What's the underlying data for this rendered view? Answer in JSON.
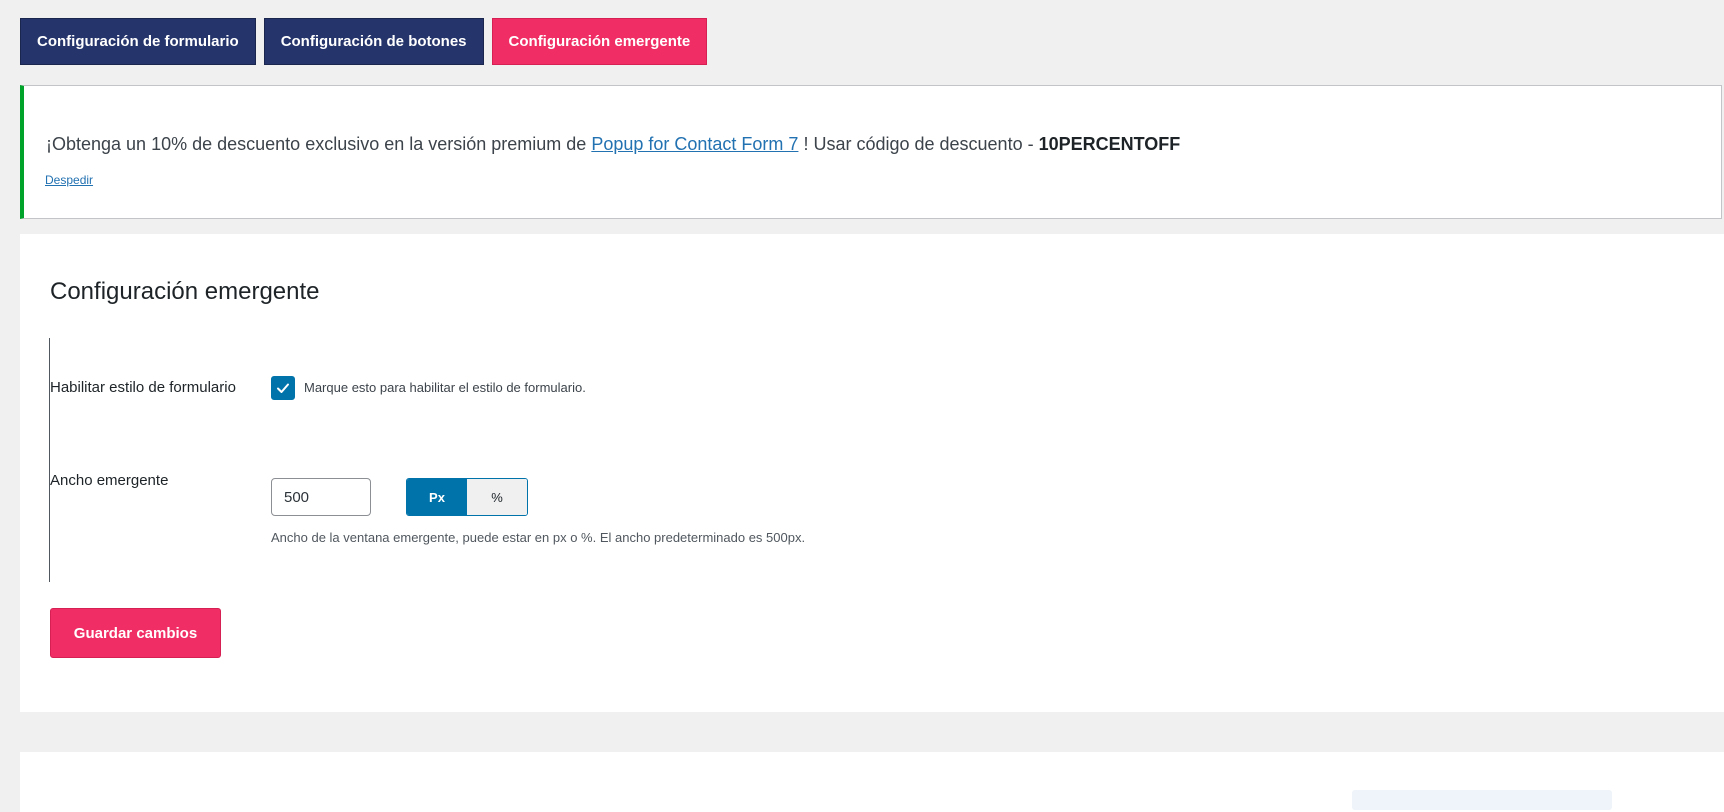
{
  "tabs": [
    {
      "label": "Configuración de formulario",
      "active": false
    },
    {
      "label": "Configuración de botones",
      "active": false
    },
    {
      "label": "Configuración emergente",
      "active": true
    }
  ],
  "notice": {
    "text_before": "¡Obtenga un 10% de descuento exclusivo en la versión premium de ",
    "link_text": "Popup for Contact Form 7",
    "text_after": " ! Usar código de descuento - ",
    "code": "10PERCENTOFF",
    "dismiss_label": "Despedir"
  },
  "settings": {
    "title": "Configuración emergente",
    "form_style": {
      "label": "Habilitar estilo de formulario",
      "checked": true,
      "description": "Marque esto para habilitar el estilo de formulario."
    },
    "popup_width": {
      "label": "Ancho emergente",
      "value": "500",
      "units": [
        "Px",
        "%"
      ],
      "selected_unit": "Px",
      "description": "Ancho de la ventana emergente, puede estar en px o %. El ancho predeterminado es 500px."
    },
    "save_label": "Guardar cambios"
  },
  "colors": {
    "tab_default": "#25346b",
    "accent_pink": "#f02e65",
    "wp_blue": "#0073aa",
    "notice_success": "#00a32a"
  }
}
